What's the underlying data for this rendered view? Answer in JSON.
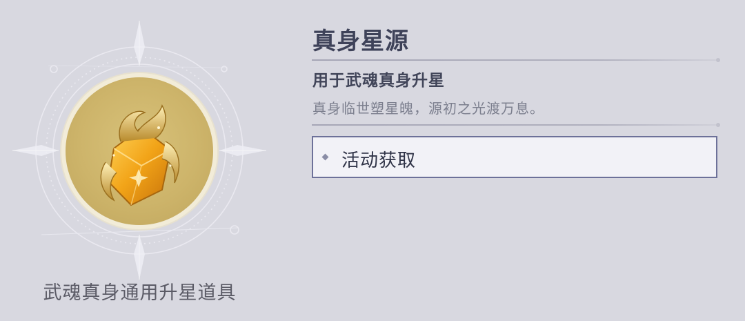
{
  "item": {
    "title": "真身星源",
    "usage": "用于武魂真身升星",
    "description": "真身临世塑星魄，源初之光渡万息。",
    "caption": "武魂真身通用升星道具",
    "icon": "golden-star-crystal-icon"
  },
  "sources": [
    {
      "label": "活动获取"
    }
  ],
  "colors": {
    "background": "#d8d8e0",
    "title": "#3e4259",
    "source_border": "#6d7199",
    "coin_gold": "#cdb46a"
  }
}
